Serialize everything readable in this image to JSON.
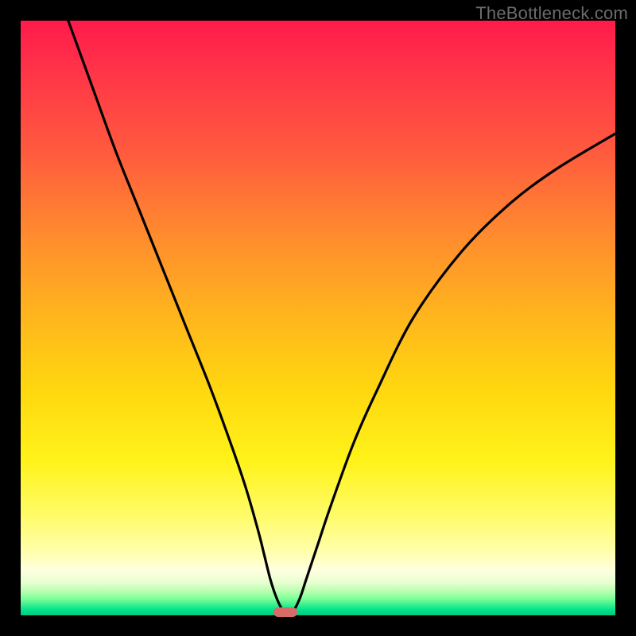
{
  "watermark": "TheBottleneck.com",
  "colors": {
    "frame": "#000000",
    "gradient_top": "#ff1a4b",
    "gradient_mid": "#ffe91a",
    "gradient_bottom": "#00c97f",
    "curve": "#000000",
    "marker": "#d86a6a"
  },
  "chart_data": {
    "type": "line",
    "title": "",
    "xlabel": "",
    "ylabel": "",
    "xlim": [
      0,
      100
    ],
    "ylim": [
      0,
      100
    ],
    "grid": false,
    "legend": false,
    "annotations": [
      {
        "kind": "marker-pill",
        "x": 44.5,
        "y": 0.5
      }
    ],
    "series": [
      {
        "name": "curve",
        "x": [
          8,
          12,
          16,
          20,
          24,
          28,
          32,
          36,
          38,
          40,
          41,
          42,
          43,
          44,
          45,
          46,
          47,
          48,
          50,
          52,
          56,
          60,
          66,
          74,
          82,
          90,
          100
        ],
        "y": [
          100,
          89,
          78,
          68,
          58,
          48,
          38,
          27,
          21,
          14,
          10,
          6,
          3,
          1,
          0.5,
          1,
          3,
          6,
          12,
          18,
          29,
          38,
          50,
          61,
          69,
          75,
          81
        ]
      }
    ]
  }
}
